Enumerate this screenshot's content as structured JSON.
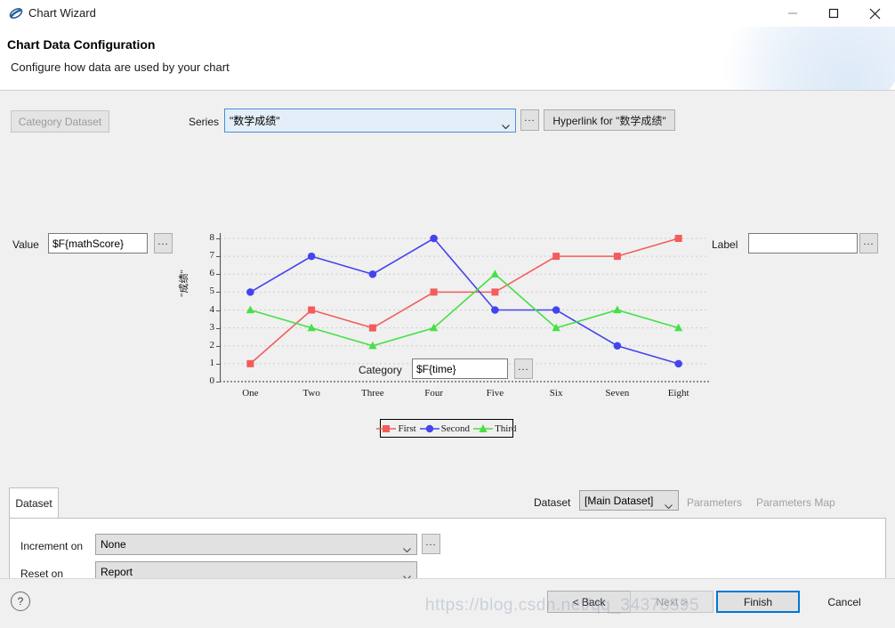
{
  "window": {
    "title": "Chart Wizard",
    "icon": "chart-wizard-icon",
    "minimize": "minimize-icon",
    "maximize": "maximize-icon",
    "close": "close-icon"
  },
  "header": {
    "title": "Chart Data Configuration",
    "subtitle": "Configure how data are used by your chart"
  },
  "form": {
    "category_dataset_label": "Category Dataset",
    "series_label": "Series",
    "series_value": "\"数学成绩\"",
    "series_ellipsis": "...",
    "hyperlink_label": "Hyperlink for \"数学成绩\"",
    "value_label": "Value",
    "value_value": "$F{mathScore}",
    "value_ellipsis": "...",
    "label_label": "Label",
    "label_value": "",
    "label_placeholder": "",
    "label_ellipsis": "...",
    "category_label": "Category",
    "category_value": "$F{time}",
    "category_ellipsis": "..."
  },
  "tabs": {
    "dataset_tab": "Dataset",
    "dataset_label": "Dataset",
    "dataset_value": "[Main Dataset]",
    "parameters_label": "Parameters",
    "parameters_map_label": "Parameters Map",
    "increment_on_label": "Increment on",
    "increment_on_value": "None",
    "increment_ellipsis": "...",
    "reset_on_label": "Reset on",
    "reset_on_value": "Report"
  },
  "footer": {
    "help": "?",
    "back": "< Back",
    "next": "Next >",
    "finish": "Finish",
    "cancel": "Cancel",
    "watermark": "https://blog.csdn.net/qq_34373595"
  },
  "chart_data": {
    "type": "line",
    "title": "",
    "xlabel": "",
    "ylabel": "\"成绩\"",
    "categories": [
      "One",
      "Two",
      "Three",
      "Four",
      "Five",
      "Six",
      "Seven",
      "Eight"
    ],
    "ylim": [
      0,
      8
    ],
    "yticks": [
      0,
      1,
      2,
      3,
      4,
      5,
      6,
      7,
      8
    ],
    "grid": true,
    "legend_position": "bottom",
    "series": [
      {
        "name": "First",
        "color": "#f45b5b",
        "marker": "square",
        "values": [
          1,
          4,
          3,
          5,
          5,
          7,
          7,
          8
        ]
      },
      {
        "name": "Second",
        "color": "#4444ee",
        "marker": "circle",
        "values": [
          5,
          7,
          6,
          8,
          4,
          4,
          2,
          1
        ]
      },
      {
        "name": "Third",
        "color": "#45e045",
        "marker": "triangle",
        "values": [
          4,
          3,
          2,
          3,
          6,
          3,
          4,
          3
        ]
      }
    ]
  }
}
